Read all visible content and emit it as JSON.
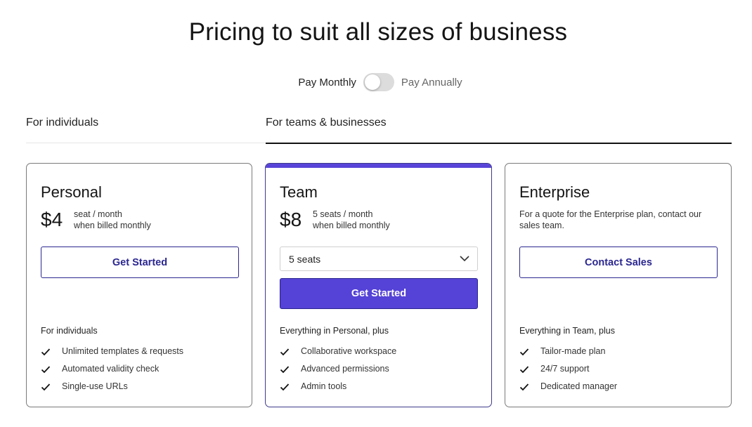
{
  "page": {
    "title": "Pricing to suit all sizes of business"
  },
  "billing": {
    "monthly_label": "Pay Monthly",
    "annually_label": "Pay Annually",
    "annual_enabled": false
  },
  "tabs": [
    {
      "label": "For individuals",
      "active": false
    },
    {
      "label": "For teams & businesses",
      "active": true
    }
  ],
  "plans": {
    "personal": {
      "name": "Personal",
      "price": "$4",
      "price_unit": "seat / month",
      "billing_note": "when billed monthly",
      "cta_label": "Get Started",
      "features_heading": "For individuals",
      "features": [
        "Unlimited templates & requests",
        "Automated validity check",
        "Single-use URLs"
      ]
    },
    "team": {
      "name": "Team",
      "price": "$8",
      "price_unit": "5 seats / month",
      "billing_note": "when billed monthly",
      "seat_selection": "5 seats",
      "cta_label": "Get Started",
      "features_heading": "Everything in Personal, plus",
      "features": [
        "Collaborative workspace",
        "Advanced permissions",
        "Admin tools"
      ],
      "accent_color": "#5542d6"
    },
    "enterprise": {
      "name": "Enterprise",
      "description": "For a quote for the Enterprise plan, contact our sales team.",
      "cta_label": "Contact Sales",
      "features_heading": "Everything in Team, plus",
      "features": [
        "Tailor-made plan",
        "24/7 support",
        "Dedicated manager"
      ]
    }
  },
  "icons": {
    "feature_check": "check-icon",
    "select_chevron": "chevron-down-icon"
  }
}
